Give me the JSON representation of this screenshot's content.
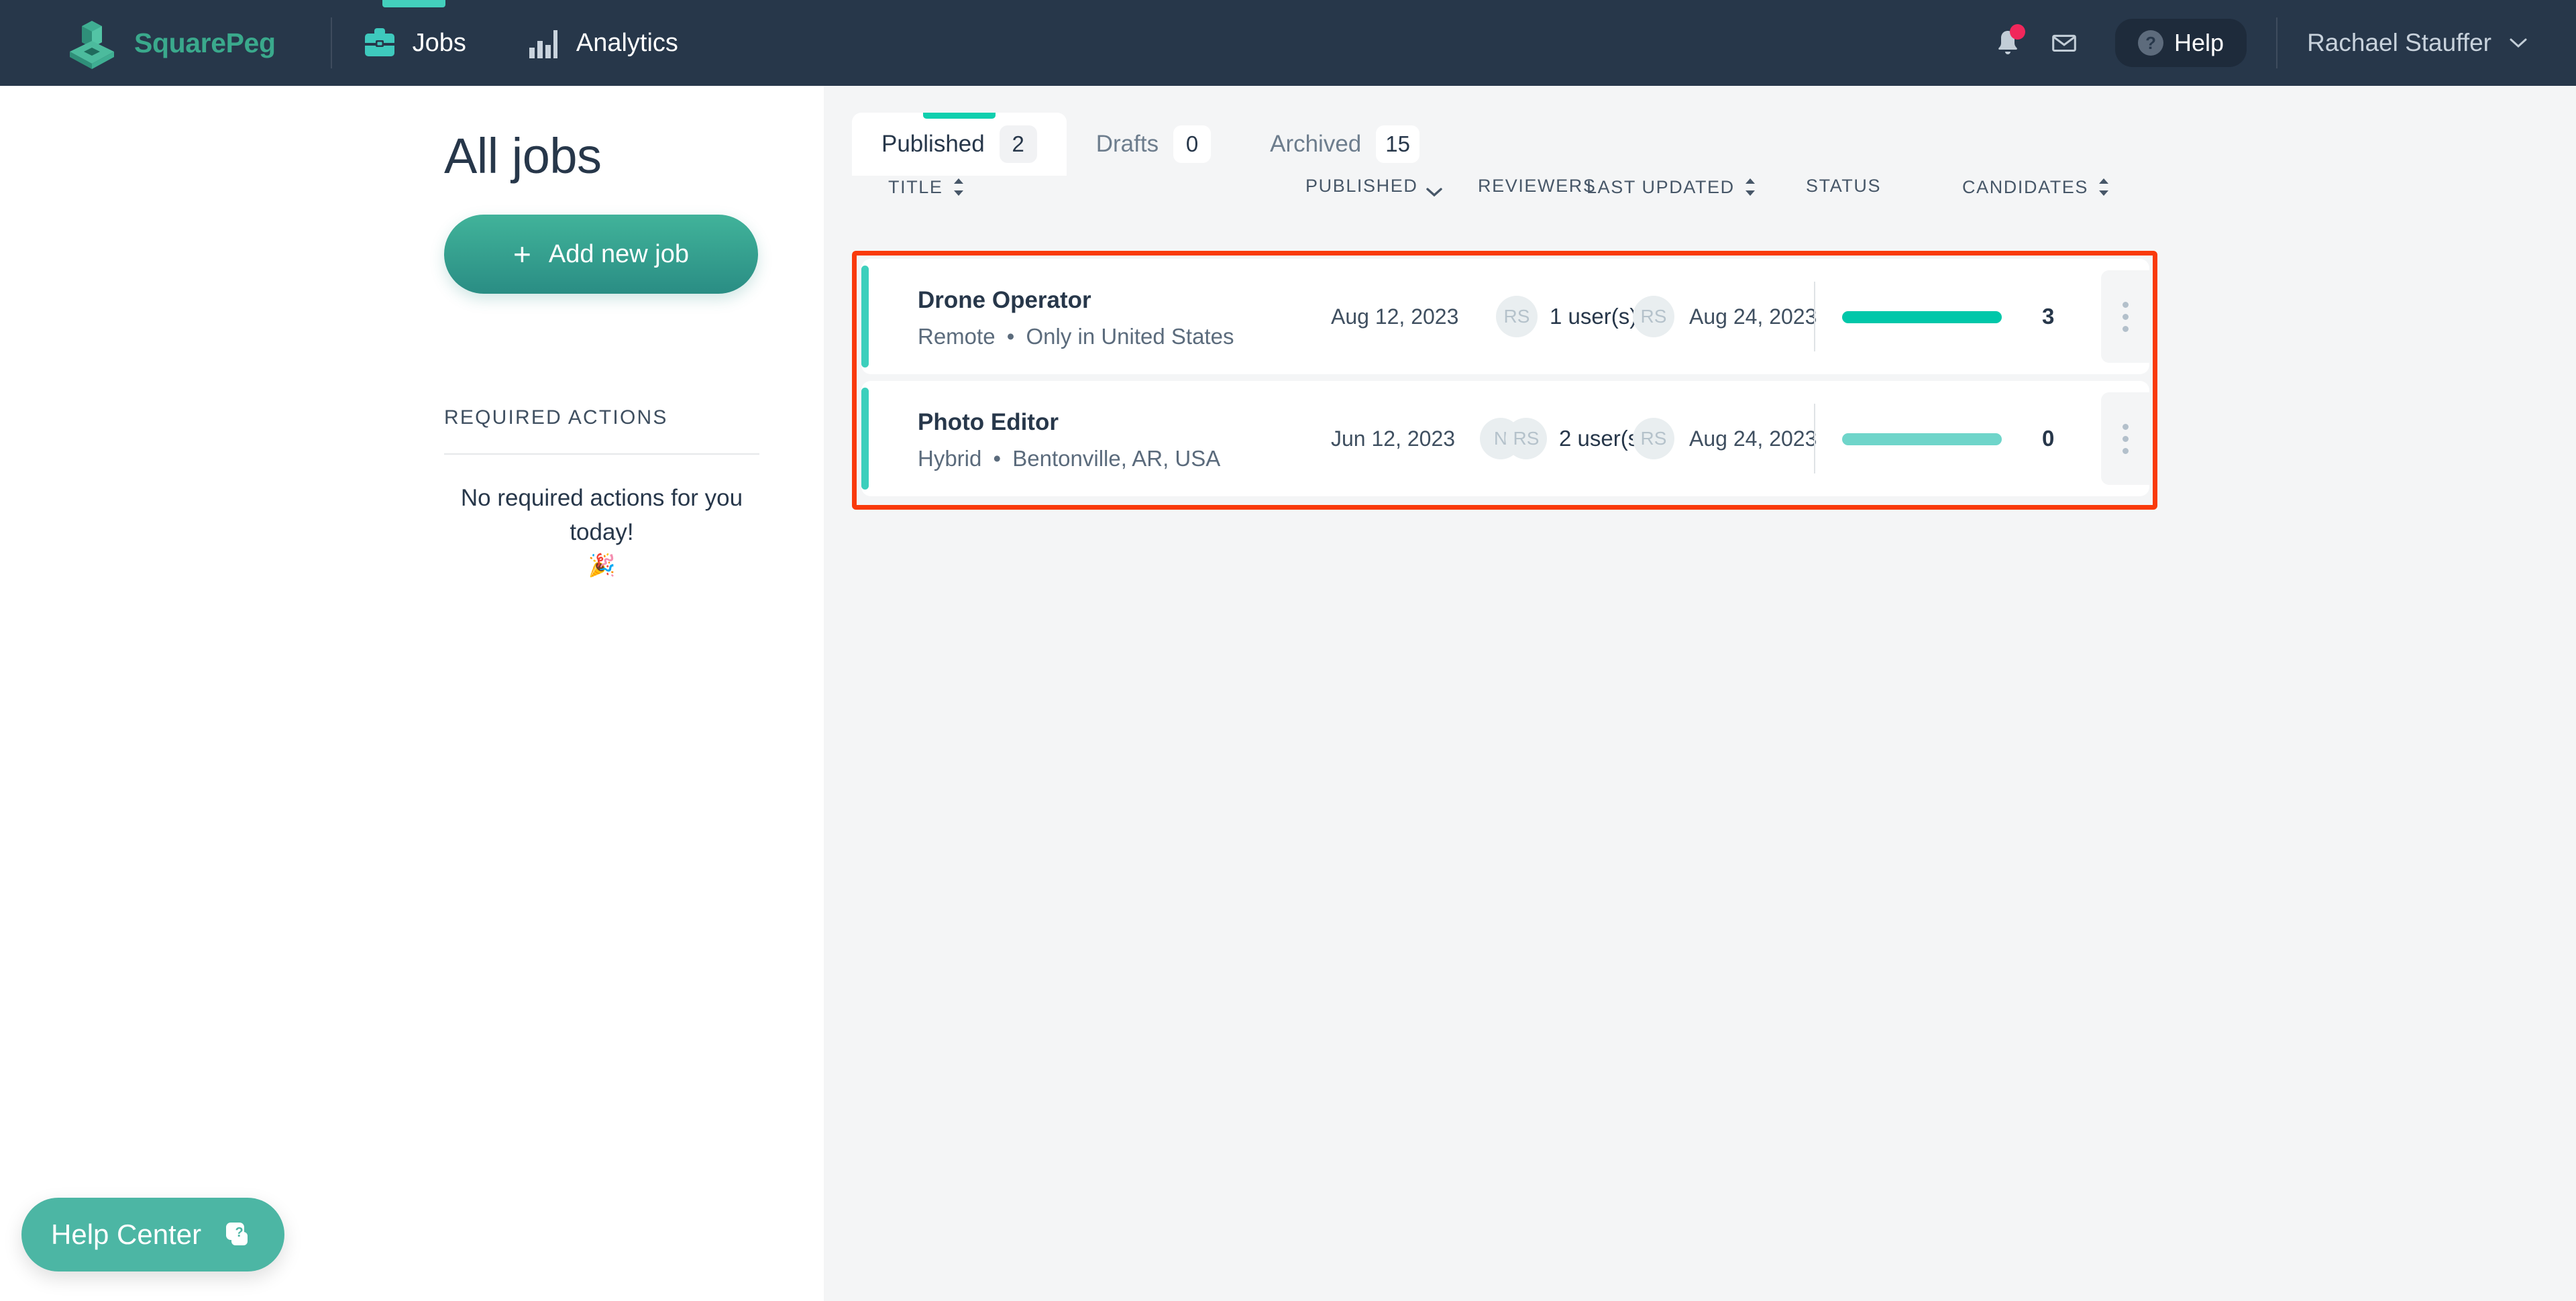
{
  "brand": {
    "name": "SquarePeg",
    "logo_icon": "squarepeg-logo-icon"
  },
  "topnav": {
    "items": [
      {
        "label": "Jobs",
        "icon": "briefcase-icon",
        "active": true
      },
      {
        "label": "Analytics",
        "icon": "bar-chart-icon",
        "active": false
      }
    ],
    "notifications_icon": "bell-icon",
    "messages_icon": "envelope-icon",
    "help_label": "Help",
    "help_icon": "question-circle-icon",
    "user_name": "Rachael Stauffer",
    "user_chevron_icon": "chevron-down-icon"
  },
  "sidebar": {
    "page_title": "All jobs",
    "add_job_label": "Add new job",
    "add_job_icon": "plus-icon",
    "required_actions_title": "REQUIRED ACTIONS",
    "empty_message": "No required actions for you today!",
    "empty_emoji": "🎉"
  },
  "tabs": [
    {
      "label": "Published",
      "count": "2",
      "active": true
    },
    {
      "label": "Drafts",
      "count": "0",
      "active": false
    },
    {
      "label": "Archived",
      "count": "15",
      "active": false
    }
  ],
  "table": {
    "columns": [
      {
        "label": "TITLE",
        "sort_icon": "sort-updown-icon"
      },
      {
        "label": "PUBLISHED",
        "sort_icon": "chevron-down-icon"
      },
      {
        "label": "REVIEWERS",
        "sort_icon": ""
      },
      {
        "label": "LAST UPDATED",
        "sort_icon": "sort-updown-icon"
      },
      {
        "label": "STATUS",
        "sort_icon": ""
      },
      {
        "label": "CANDIDATES",
        "sort_icon": "sort-updown-icon"
      }
    ],
    "rows": [
      {
        "title": "Drone Operator",
        "work_mode": "Remote",
        "location": "Only in United States",
        "published": "Aug 12, 2023",
        "reviewer_avatars": [
          "RS"
        ],
        "reviewers_text": "1 user(s)",
        "updated_avatar": "RS",
        "last_updated": "Aug 24, 2023",
        "status_fill_pct": 100,
        "status_color": "#00c7a9",
        "candidates": "3",
        "menu_icon": "kebab-menu-icon"
      },
      {
        "title": "Photo Editor",
        "work_mode": "Hybrid",
        "location": "Bentonville, AR, USA",
        "published": "Jun 12, 2023",
        "reviewer_avatars": [
          "N",
          "RS"
        ],
        "reviewers_text": "2 user(s)",
        "updated_avatar": "RS",
        "last_updated": "Aug 24, 2023",
        "status_fill_pct": 100,
        "status_color": "#6fd5ca",
        "candidates": "0",
        "menu_icon": "kebab-menu-icon"
      }
    ]
  },
  "help_center": {
    "label": "Help Center",
    "icon": "help-chat-icon"
  },
  "annotation": {
    "highlight_color": "#f93a0b"
  },
  "colors": {
    "nav_bg": "#27374a",
    "brand_green": "#3aa98c",
    "accent_teal": "#3ccfbc",
    "page_bg": "#f4f5f6",
    "text_dark": "#27374a",
    "badge_pink": "#f1275b"
  }
}
